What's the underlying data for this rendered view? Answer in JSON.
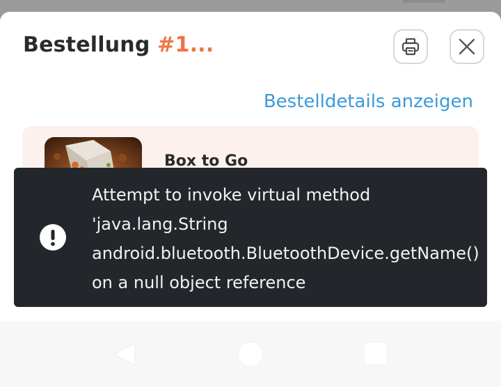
{
  "header": {
    "title_prefix": "Bestellung",
    "order_number": "#1...",
    "print_icon": "printer-icon",
    "close_icon": "close-icon"
  },
  "details_link": "Bestelldetails anzeigen",
  "item": {
    "name": "Box to Go"
  },
  "snackbar": {
    "icon": "exclamation-circle-icon",
    "message": "Attempt to invoke virtual method\n'java.lang.String\nandroid.bluetooth.BluetoothDevice.getName()\non a null object reference"
  },
  "navbar": {
    "back_icon": "back-triangle-icon",
    "home_icon": "home-circle-icon",
    "recents_icon": "recents-square-icon"
  },
  "colors": {
    "accent": "#f07543",
    "link": "#3a9ad9",
    "snackbar_bg": "#23272b",
    "card_bg": "#fdf1ed"
  }
}
